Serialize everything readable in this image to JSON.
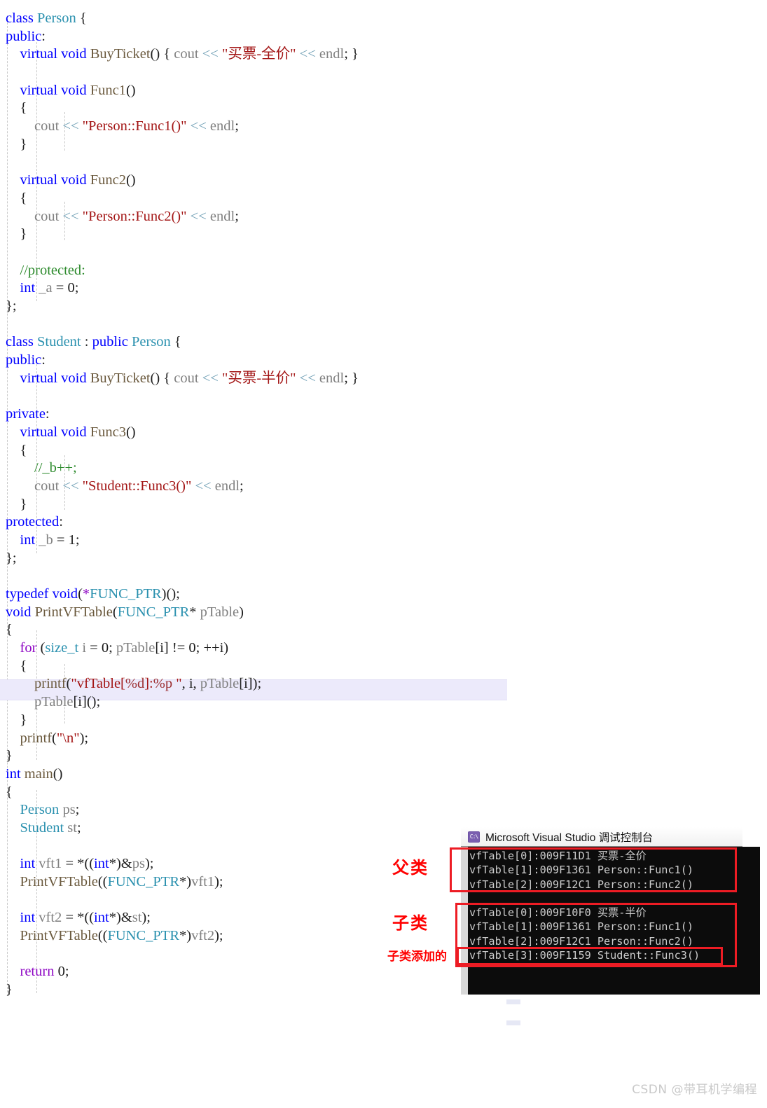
{
  "editor": {
    "language": "cpp",
    "lines": [
      [
        {
          "t": "class ",
          "c": "kw"
        },
        {
          "t": "Person",
          "c": "type"
        },
        {
          "t": " {",
          "c": "op"
        }
      ],
      [
        {
          "t": "public",
          "c": "kw"
        },
        {
          "t": ":",
          "c": "op"
        }
      ],
      [
        {
          "t": "    ",
          "c": "op"
        },
        {
          "t": "virtual ",
          "c": "kw"
        },
        {
          "t": "void ",
          "c": "kw"
        },
        {
          "t": "BuyTicket",
          "c": "fn"
        },
        {
          "t": "() { ",
          "c": "op"
        },
        {
          "t": "cout ",
          "c": "id"
        },
        {
          "t": "<< ",
          "c": "sh"
        },
        {
          "t": "\"买票-全价\"",
          "c": "str"
        },
        {
          "t": " << ",
          "c": "sh"
        },
        {
          "t": "endl",
          "c": "id"
        },
        {
          "t": "; }",
          "c": "op"
        }
      ],
      [],
      [
        {
          "t": "    ",
          "c": "op"
        },
        {
          "t": "virtual ",
          "c": "kw"
        },
        {
          "t": "void ",
          "c": "kw"
        },
        {
          "t": "Func1",
          "c": "fn"
        },
        {
          "t": "()",
          "c": "op"
        }
      ],
      [
        {
          "t": "    {",
          "c": "op"
        }
      ],
      [
        {
          "t": "        ",
          "c": "op"
        },
        {
          "t": "cout ",
          "c": "id"
        },
        {
          "t": "<< ",
          "c": "sh"
        },
        {
          "t": "\"Person::Func1()\"",
          "c": "str"
        },
        {
          "t": " << ",
          "c": "sh"
        },
        {
          "t": "endl",
          "c": "id"
        },
        {
          "t": ";",
          "c": "op"
        }
      ],
      [
        {
          "t": "    }",
          "c": "op"
        }
      ],
      [],
      [
        {
          "t": "    ",
          "c": "op"
        },
        {
          "t": "virtual ",
          "c": "kw"
        },
        {
          "t": "void ",
          "c": "kw"
        },
        {
          "t": "Func2",
          "c": "fn"
        },
        {
          "t": "()",
          "c": "op"
        }
      ],
      [
        {
          "t": "    {",
          "c": "op"
        }
      ],
      [
        {
          "t": "        ",
          "c": "op"
        },
        {
          "t": "cout ",
          "c": "id"
        },
        {
          "t": "<< ",
          "c": "sh"
        },
        {
          "t": "\"Person::Func2()\"",
          "c": "str"
        },
        {
          "t": " << ",
          "c": "sh"
        },
        {
          "t": "endl",
          "c": "id"
        },
        {
          "t": ";",
          "c": "op"
        }
      ],
      [
        {
          "t": "    }",
          "c": "op"
        }
      ],
      [],
      [
        {
          "t": "    ",
          "c": "op"
        },
        {
          "t": "//protected:",
          "c": "cmt"
        }
      ],
      [
        {
          "t": "    ",
          "c": "op"
        },
        {
          "t": "int ",
          "c": "kw"
        },
        {
          "t": "_a ",
          "c": "id"
        },
        {
          "t": "= ",
          "c": "op"
        },
        {
          "t": "0",
          "c": "num"
        },
        {
          "t": ";",
          "c": "op"
        }
      ],
      [
        {
          "t": "};",
          "c": "op"
        }
      ],
      [],
      [
        {
          "t": "class ",
          "c": "kw"
        },
        {
          "t": "Student ",
          "c": "type"
        },
        {
          "t": ": ",
          "c": "op"
        },
        {
          "t": "public ",
          "c": "kw"
        },
        {
          "t": "Person",
          "c": "type"
        },
        {
          "t": " {",
          "c": "op"
        }
      ],
      [
        {
          "t": "public",
          "c": "kw"
        },
        {
          "t": ":",
          "c": "op"
        }
      ],
      [
        {
          "t": "    ",
          "c": "op"
        },
        {
          "t": "virtual ",
          "c": "kw"
        },
        {
          "t": "void ",
          "c": "kw"
        },
        {
          "t": "BuyTicket",
          "c": "fn"
        },
        {
          "t": "() { ",
          "c": "op"
        },
        {
          "t": "cout ",
          "c": "id"
        },
        {
          "t": "<< ",
          "c": "sh"
        },
        {
          "t": "\"买票-半价\"",
          "c": "str"
        },
        {
          "t": " << ",
          "c": "sh"
        },
        {
          "t": "endl",
          "c": "id"
        },
        {
          "t": "; }",
          "c": "op"
        }
      ],
      [],
      [
        {
          "t": "private",
          "c": "kw"
        },
        {
          "t": ":",
          "c": "op"
        }
      ],
      [
        {
          "t": "    ",
          "c": "op"
        },
        {
          "t": "virtual ",
          "c": "kw"
        },
        {
          "t": "void ",
          "c": "kw"
        },
        {
          "t": "Func3",
          "c": "fn"
        },
        {
          "t": "()",
          "c": "op"
        }
      ],
      [
        {
          "t": "    {",
          "c": "op"
        }
      ],
      [
        {
          "t": "        ",
          "c": "op"
        },
        {
          "t": "//_b++;",
          "c": "cmt"
        }
      ],
      [
        {
          "t": "        ",
          "c": "op"
        },
        {
          "t": "cout ",
          "c": "id"
        },
        {
          "t": "<< ",
          "c": "sh"
        },
        {
          "t": "\"Student::Func3()\"",
          "c": "str"
        },
        {
          "t": " << ",
          "c": "sh"
        },
        {
          "t": "endl",
          "c": "id"
        },
        {
          "t": ";",
          "c": "op"
        }
      ],
      [
        {
          "t": "    }",
          "c": "op"
        }
      ],
      [
        {
          "t": "protected",
          "c": "kw"
        },
        {
          "t": ":",
          "c": "op"
        }
      ],
      [
        {
          "t": "    ",
          "c": "op"
        },
        {
          "t": "int ",
          "c": "kw"
        },
        {
          "t": "_b ",
          "c": "id"
        },
        {
          "t": "= ",
          "c": "op"
        },
        {
          "t": "1",
          "c": "num"
        },
        {
          "t": ";",
          "c": "op"
        }
      ],
      [
        {
          "t": "};",
          "c": "op"
        }
      ],
      [],
      [
        {
          "t": "typedef ",
          "c": "kw"
        },
        {
          "t": "void",
          "c": "kw"
        },
        {
          "t": "(",
          "c": "op"
        },
        {
          "t": "*",
          "c": "kw2"
        },
        {
          "t": "FUNC_PTR",
          "c": "type"
        },
        {
          "t": ")();",
          "c": "op"
        }
      ],
      [
        {
          "t": "void ",
          "c": "kw"
        },
        {
          "t": "PrintVFTable",
          "c": "fn"
        },
        {
          "t": "(",
          "c": "op"
        },
        {
          "t": "FUNC_PTR",
          "c": "type"
        },
        {
          "t": "* ",
          "c": "op"
        },
        {
          "t": "pTable",
          "c": "id"
        },
        {
          "t": ")",
          "c": "op"
        }
      ],
      [
        {
          "t": "{",
          "c": "op"
        }
      ],
      [
        {
          "t": "    ",
          "c": "op"
        },
        {
          "t": "for ",
          "c": "kw2"
        },
        {
          "t": "(",
          "c": "op"
        },
        {
          "t": "size_t ",
          "c": "type"
        },
        {
          "t": "i ",
          "c": "id"
        },
        {
          "t": "= ",
          "c": "op"
        },
        {
          "t": "0",
          "c": "num"
        },
        {
          "t": "; ",
          "c": "op"
        },
        {
          "t": "pTable",
          "c": "id"
        },
        {
          "t": "[i] ",
          "c": "op"
        },
        {
          "t": "!= ",
          "c": "op"
        },
        {
          "t": "0",
          "c": "num"
        },
        {
          "t": "; ++i)",
          "c": "op"
        }
      ],
      [
        {
          "t": "    {",
          "c": "op"
        }
      ],
      [
        {
          "t": "        ",
          "c": "op"
        },
        {
          "t": "printf",
          "c": "fn"
        },
        {
          "t": "(",
          "c": "op"
        },
        {
          "t": "\"vfTable[",
          "c": "str"
        },
        {
          "t": "%d",
          "c": "fmt"
        },
        {
          "t": "]:",
          "c": "str"
        },
        {
          "t": "%p",
          "c": "fmt"
        },
        {
          "t": " \"",
          "c": "str"
        },
        {
          "t": ", i, ",
          "c": "op"
        },
        {
          "t": "pTable",
          "c": "id"
        },
        {
          "t": "[i]);",
          "c": "op"
        }
      ],
      [
        {
          "t": "        ",
          "c": "op"
        },
        {
          "t": "pTable",
          "c": "id"
        },
        {
          "t": "[i]();",
          "c": "op"
        }
      ],
      [
        {
          "t": "    }",
          "c": "op"
        }
      ],
      [
        {
          "t": "    ",
          "c": "op"
        },
        {
          "t": "printf",
          "c": "fn"
        },
        {
          "t": "(",
          "c": "op"
        },
        {
          "t": "\"\\n\"",
          "c": "str"
        },
        {
          "t": ");",
          "c": "op"
        }
      ],
      [
        {
          "t": "}",
          "c": "op"
        }
      ],
      [
        {
          "t": "int ",
          "c": "kw"
        },
        {
          "t": "main",
          "c": "fn"
        },
        {
          "t": "()",
          "c": "op"
        }
      ],
      [
        {
          "t": "{",
          "c": "op"
        }
      ],
      [
        {
          "t": "    ",
          "c": "op"
        },
        {
          "t": "Person ",
          "c": "type"
        },
        {
          "t": "ps",
          "c": "id"
        },
        {
          "t": ";",
          "c": "op"
        }
      ],
      [
        {
          "t": "    ",
          "c": "op"
        },
        {
          "t": "Student ",
          "c": "type"
        },
        {
          "t": "st",
          "c": "id"
        },
        {
          "t": ";",
          "c": "op"
        }
      ],
      [],
      [
        {
          "t": "    ",
          "c": "op"
        },
        {
          "t": "int ",
          "c": "kw"
        },
        {
          "t": "vft1 ",
          "c": "id"
        },
        {
          "t": "= *((",
          "c": "op"
        },
        {
          "t": "int",
          "c": "kw"
        },
        {
          "t": "*)&",
          "c": "op"
        },
        {
          "t": "ps",
          "c": "id"
        },
        {
          "t": ");",
          "c": "op"
        }
      ],
      [
        {
          "t": "    ",
          "c": "op"
        },
        {
          "t": "PrintVFTable",
          "c": "fn"
        },
        {
          "t": "((",
          "c": "op"
        },
        {
          "t": "FUNC_PTR",
          "c": "type"
        },
        {
          "t": "*)",
          "c": "op"
        },
        {
          "t": "vft1",
          "c": "id"
        },
        {
          "t": ");",
          "c": "op"
        }
      ],
      [],
      [
        {
          "t": "    ",
          "c": "op"
        },
        {
          "t": "int ",
          "c": "kw"
        },
        {
          "t": "vft2 ",
          "c": "id"
        },
        {
          "t": "= *((",
          "c": "op"
        },
        {
          "t": "int",
          "c": "kw"
        },
        {
          "t": "*)&",
          "c": "op"
        },
        {
          "t": "st",
          "c": "id"
        },
        {
          "t": ");",
          "c": "op"
        }
      ],
      [
        {
          "t": "    ",
          "c": "op"
        },
        {
          "t": "PrintVFTable",
          "c": "fn"
        },
        {
          "t": "((",
          "c": "op"
        },
        {
          "t": "FUNC_PTR",
          "c": "type"
        },
        {
          "t": "*)",
          "c": "op"
        },
        {
          "t": "vft2",
          "c": "id"
        },
        {
          "t": ");",
          "c": "op"
        }
      ],
      [],
      [
        {
          "t": "    ",
          "c": "op"
        },
        {
          "t": "return ",
          "c": "kw2"
        },
        {
          "t": "0",
          "c": "num"
        },
        {
          "t": ";",
          "c": "op"
        }
      ],
      [
        {
          "t": "}",
          "c": "op"
        }
      ]
    ]
  },
  "console": {
    "icon": "vs-console-icon",
    "icon_glyph": "C:\\",
    "title": "Microsoft Visual Studio 调试控制台",
    "output_lines": [
      "vfTable[0]:009F11D1 买票-全价",
      "vfTable[1]:009F1361 Person::Func1()",
      "vfTable[2]:009F12C1 Person::Func2()",
      "",
      "vfTable[0]:009F10F0 买票-半价",
      "vfTable[1]:009F1361 Person::Func1()",
      "vfTable[2]:009F12C1 Person::Func2()",
      "vfTable[3]:009F1159 Student::Func3()"
    ]
  },
  "annotations": {
    "color": "#ff0000",
    "box_color": "#ed1c24",
    "parent_label": "父类",
    "child_label": "子类",
    "added_label": "子类添加的"
  },
  "watermark": {
    "text": "CSDN @带耳机学编程",
    "color": "#c9c9c9"
  }
}
